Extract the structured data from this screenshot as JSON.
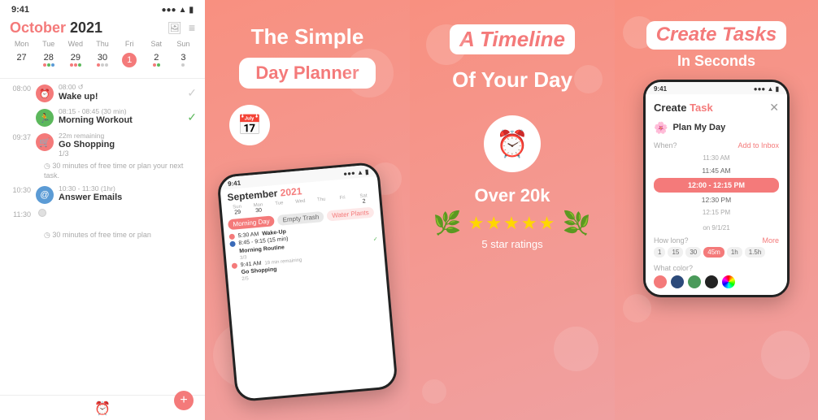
{
  "panel1": {
    "status_time": "9:41",
    "month": "October",
    "year": " 2021",
    "day_labels": [
      "Mon",
      "Tue",
      "Wed",
      "Thu",
      "Fri",
      "Sat",
      "Sun"
    ],
    "days": [
      {
        "num": "27",
        "dots": []
      },
      {
        "num": "28",
        "dots": [
          "pink",
          "green",
          "blue"
        ]
      },
      {
        "num": "29",
        "dots": [
          "pink",
          "pink",
          "green"
        ]
      },
      {
        "num": "30",
        "dots": [
          "pink",
          "gray",
          "gray"
        ]
      },
      {
        "num": "1",
        "today": true,
        "dots": [
          "pink"
        ]
      },
      {
        "num": "2",
        "dots": [
          "pink",
          "green"
        ]
      },
      {
        "num": "3",
        "dots": [
          "gray"
        ]
      }
    ],
    "tasks": [
      {
        "time": "08:00",
        "label": "08:00 ↺",
        "name": "Wake up!",
        "icon": "alarm",
        "color": "pink"
      },
      {
        "time": "",
        "label": "08:15 - 08:45 (30 min)",
        "name": "Morning Workout",
        "icon": "run",
        "color": "green",
        "check": true
      },
      {
        "time": "09:37",
        "label": "22m remaining",
        "name": "Go Shopping",
        "icon": "cart",
        "color": "pink",
        "sub": "1/3"
      },
      {
        "free_time": "30 minutes of free time or plan your next task."
      },
      {
        "time": "10:30",
        "label": "10:30 - 11:30 (1hr)",
        "name": "Answer Emails",
        "icon": "email",
        "color": "blue"
      },
      {
        "time": "11:30",
        "label": ""
      }
    ]
  },
  "panel2": {
    "title": "The Simple",
    "subtitle": "Day Planner",
    "calendar_icon": "📅",
    "phone": {
      "status_time": "9:41",
      "month": "September",
      "year": " 2021",
      "day_labels": [
        "Sun",
        "Mon",
        "Tue",
        "Wed",
        "Thu",
        "Fri",
        "Sat"
      ],
      "days": [
        "29",
        "30",
        "",
        "",
        "Tue",
        "Wed",
        "2"
      ],
      "task_rows": [
        {
          "label": "Morning Day",
          "type": "pink"
        },
        {
          "label": "Empty Trash",
          "type": "gray"
        },
        {
          "label": "Water Plants",
          "type": "light"
        }
      ],
      "timeline": [
        {
          "time": "5:30 AM",
          "name": "Wake-Up",
          "dot": "pink"
        },
        {
          "time": "8:45 AM",
          "name": "Morning Routine",
          "dot": "blue",
          "sub": "3/3"
        },
        {
          "time": "9:41 AM",
          "name": "Go Shopping",
          "dot": "pink",
          "sub": "2/5"
        }
      ]
    }
  },
  "panel3": {
    "title_highlight": "A Timeline",
    "title_rest": "Of Your Day",
    "alarm_icon": "⏰",
    "rating_count": "Over 20k",
    "stars": "★★★★★",
    "star_label": "5 star ratings",
    "wreath_left": "🌿",
    "wreath_right": "🌿"
  },
  "panel4": {
    "title_highlight": "Create Tasks",
    "title_subtitle": "In Seconds",
    "phone": {
      "status_time": "9:41",
      "create_task_label": "Create",
      "create_task_highlight": " Task",
      "close": "✕",
      "plan_my_day": "Plan My Day",
      "plan_icon": "🌸",
      "when_label": "When?",
      "add_inbox": "Add to Inbox",
      "times": [
        {
          "label": "11:30 AM",
          "selected": false,
          "size": "small"
        },
        {
          "label": "11:45 AM",
          "selected": false,
          "size": "medium"
        },
        {
          "label": "12:00 - 12:15 PM",
          "selected": true,
          "size": "large"
        },
        {
          "label": "12:30 PM",
          "selected": false,
          "size": "medium"
        },
        {
          "label": "12:15 PM",
          "selected": false,
          "size": "small"
        }
      ],
      "on_date": "on 9/1/21",
      "how_long": "How long?",
      "more": "More",
      "durations": [
        {
          "label": "1",
          "selected": false
        },
        {
          "label": "15",
          "selected": false
        },
        {
          "label": "30",
          "selected": false
        },
        {
          "label": "45m",
          "selected": true
        },
        {
          "label": "1h",
          "selected": false
        },
        {
          "label": "1.5h",
          "selected": false
        }
      ],
      "what_color": "What color?",
      "colors": [
        {
          "hex": "#f47a7a"
        },
        {
          "hex": "#3a5a8a"
        },
        {
          "hex": "#4a9a5a"
        },
        {
          "hex": "#222222"
        },
        {
          "hex": "rainbow"
        }
      ]
    }
  }
}
